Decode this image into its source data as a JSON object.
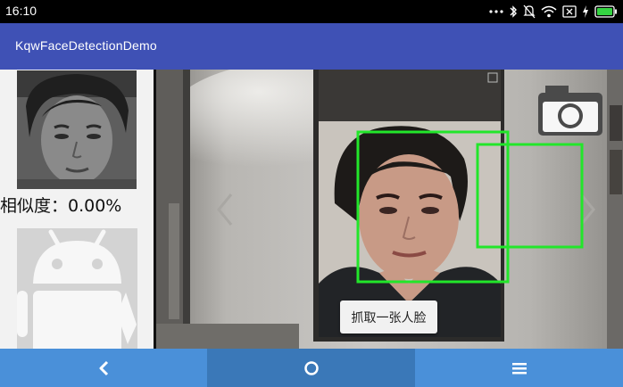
{
  "status_bar": {
    "time": "16:10",
    "icons": [
      "more-dots-icon",
      "bluetooth-icon",
      "mute-icon",
      "wifi-icon",
      "sim-x-icon",
      "charging-icon",
      "battery-icon"
    ]
  },
  "app": {
    "title": "KqwFaceDetectionDemo"
  },
  "left_panel": {
    "similarity_text": "相似度：0.00%"
  },
  "camera": {
    "capture_button_label": "抓取一张人脸"
  },
  "nav": {
    "items": [
      "back-icon",
      "home-icon",
      "menu-icon"
    ]
  },
  "colors": {
    "app_bar": "#3f51b5",
    "nav_bar": "#4a90d9",
    "nav_active": "#3a78b8",
    "face_box": "#22e62a"
  }
}
